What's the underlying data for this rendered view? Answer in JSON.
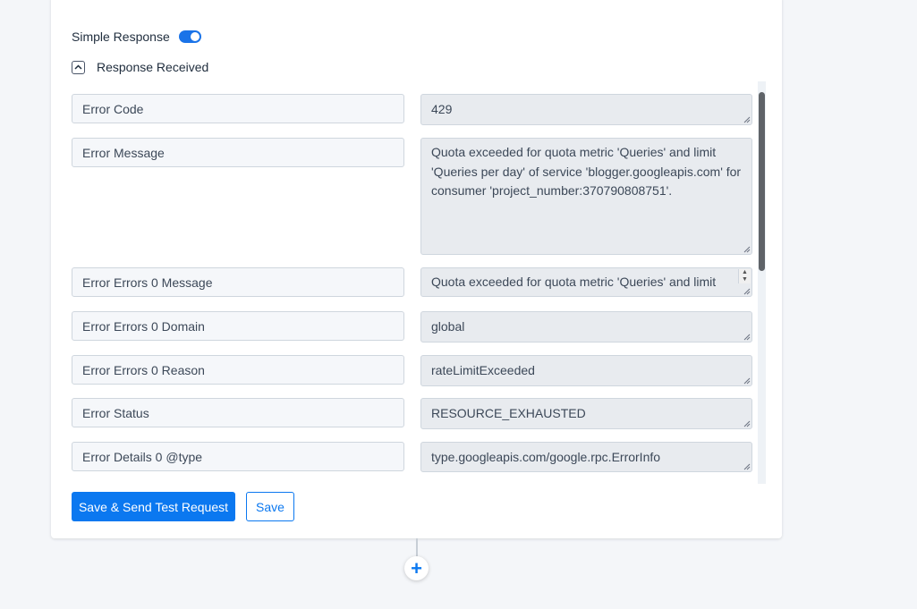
{
  "simple_response": {
    "label": "Simple Response",
    "enabled": true
  },
  "response_received": {
    "label": "Response Received",
    "expanded": true
  },
  "fields": [
    {
      "label": "Error Code",
      "value": "429"
    },
    {
      "label": "Error Message",
      "value": "Quota exceeded for quota metric 'Queries' and limit 'Queries per day' of service 'blogger.googleapis.com' for consumer 'project_number:370790808751'."
    },
    {
      "label": "Error Errors 0 Message",
      "value": "Quota exceeded for quota metric 'Queries' and limit 'Queries per day' of service"
    },
    {
      "label": "Error Errors 0 Domain",
      "value": "global"
    },
    {
      "label": "Error Errors 0 Reason",
      "value": "rateLimitExceeded"
    },
    {
      "label": "Error Status",
      "value": "RESOURCE_EXHAUSTED"
    },
    {
      "label": "Error Details 0 @type",
      "value": "type.googleapis.com/google.rpc.ErrorInfo"
    }
  ],
  "buttons": {
    "save_send": "Save & Send Test Request",
    "save": "Save"
  },
  "add_step_icon": "plus-icon",
  "colors": {
    "accent": "#0b78f0",
    "toggle": "#1a73e8"
  }
}
